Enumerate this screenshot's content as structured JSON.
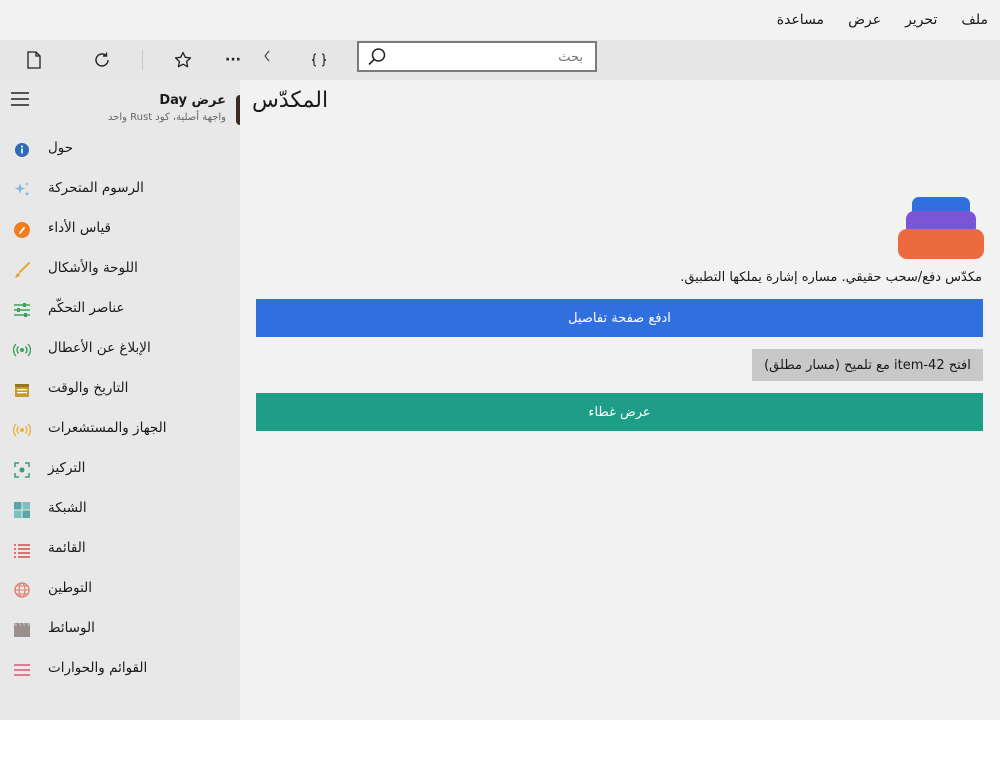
{
  "menu": {
    "items": [
      {
        "label": "ملف"
      },
      {
        "label": "تحرير"
      },
      {
        "label": "عرض"
      },
      {
        "label": "مساعدة"
      }
    ]
  },
  "toolbar": {
    "overflow_label": "···",
    "search_placeholder": "بحث"
  },
  "sidebar": {
    "app_title": "عرض Day",
    "app_subtitle": "واجهة أصلية، كود Rust واحد",
    "items": [
      {
        "label": "حول",
        "icon": "info-icon",
        "color": "#2f6bb8"
      },
      {
        "label": "الرسوم المتحركة",
        "icon": "sparkles-icon",
        "color": "#7fb8e6"
      },
      {
        "label": "قياس الأداء",
        "icon": "gauge-icon",
        "color": "#f07d1e"
      },
      {
        "label": "اللوحة والأشكال",
        "icon": "brush-icon",
        "color": "#e6a43a"
      },
      {
        "label": "عناصر التحكّم",
        "icon": "sliders-icon",
        "color": "#3aa35a"
      },
      {
        "label": "الإبلاغ عن الأعطال",
        "icon": "broadcast-icon",
        "color": "#3aa35a"
      },
      {
        "label": "التاريخ والوقت",
        "icon": "calendar-icon",
        "color": "#c79a2a"
      },
      {
        "label": "الجهاز والمستشعرات",
        "icon": "sensor-icon",
        "color": "#e6b43a"
      },
      {
        "label": "التركيز",
        "icon": "focus-icon",
        "color": "#3a9a7a"
      },
      {
        "label": "الشبكة",
        "icon": "grid-icon",
        "color": "#5aa6a6"
      },
      {
        "label": "القائمة",
        "icon": "list-icon",
        "color": "#d94a4a"
      },
      {
        "label": "التوطين",
        "icon": "globe-icon",
        "color": "#e07a6a"
      },
      {
        "label": "الوسائط",
        "icon": "film-icon",
        "color": "#9a8f8a"
      },
      {
        "label": "القوائم والحوارات",
        "icon": "menu-lines-icon",
        "color": "#e0557a"
      }
    ]
  },
  "main": {
    "title": "المكدّس",
    "description": "مكدّس دفع/سحب حقيقي. مساره إشارة يملكها التطبيق.",
    "push_button": "ادفع صفحة تفاصيل",
    "open_button": "افتح item-42 مع تلميح (مسار مطلق)",
    "overlay_button": "عرض غطاء",
    "colors": {
      "primary": "#2f6fde",
      "teal": "#1e9e86",
      "stack_top": "#2f6fde",
      "stack_mid": "#7b55d6",
      "stack_bottom": "#ec6a3e"
    }
  }
}
